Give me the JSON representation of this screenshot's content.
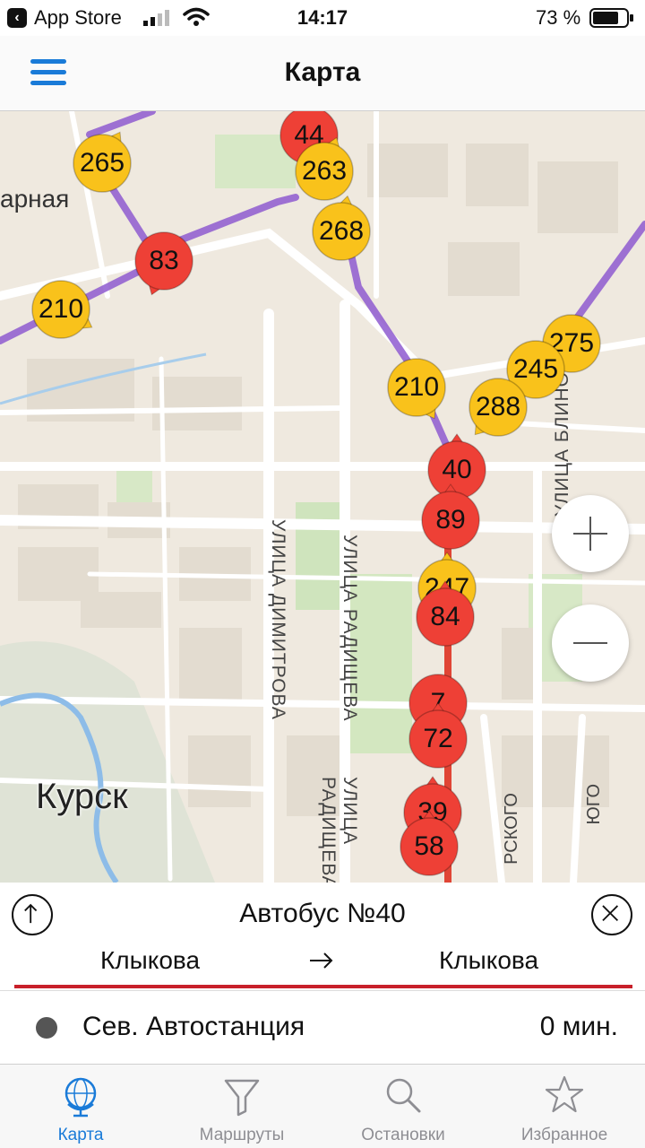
{
  "status_bar": {
    "carrier": "App Store",
    "time": "14:17",
    "battery": "73 %"
  },
  "nav": {
    "title": "Карта"
  },
  "map": {
    "labels": {
      "city": "Курск",
      "partial_top_left": "арная",
      "street_dimitrova": "УЛИЦА ДИМИТРОВА",
      "street_radishcheva_1": "УЛИЦА РАДИЩЕВА",
      "street_radishcheva_2": "УЛИЦА РАДИЩЕВА",
      "street_blinova": "УЛИЦА БЛИНО",
      "street_partial_1": "РСКОГО",
      "street_partial_2": "ЮГО"
    },
    "markers": [
      {
        "label": "44",
        "color": "red"
      },
      {
        "label": "265",
        "color": "yellow"
      },
      {
        "label": "263",
        "color": "yellow"
      },
      {
        "label": "83",
        "color": "red"
      },
      {
        "label": "268",
        "color": "yellow"
      },
      {
        "label": "210",
        "color": "yellow"
      },
      {
        "label": "210",
        "color": "yellow"
      },
      {
        "label": "275",
        "color": "yellow"
      },
      {
        "label": "245",
        "color": "yellow"
      },
      {
        "label": "288",
        "color": "yellow"
      },
      {
        "label": "40",
        "color": "red"
      },
      {
        "label": "89",
        "color": "red"
      },
      {
        "label": "247",
        "color": "yellow"
      },
      {
        "label": "84",
        "color": "red"
      },
      {
        "label": "7",
        "color": "red"
      },
      {
        "label": "72",
        "color": "red"
      },
      {
        "label": "39",
        "color": "red"
      },
      {
        "label": "58",
        "color": "red"
      }
    ],
    "zoom_in": "+",
    "zoom_out": "−"
  },
  "route_panel": {
    "title": "Автобус №40",
    "from": "Клыкова",
    "to": "Клыкова",
    "accent_color": "#c8202a",
    "stop": {
      "name": "Сев. Автостанция",
      "eta": "0 мин."
    }
  },
  "tabs": [
    {
      "label": "Карта",
      "icon": "globe-icon",
      "active": true
    },
    {
      "label": "Маршруты",
      "icon": "filter-icon",
      "active": false
    },
    {
      "label": "Остановки",
      "icon": "search-icon",
      "active": false
    },
    {
      "label": "Избранное",
      "icon": "star-icon",
      "active": false
    }
  ],
  "colors": {
    "accent": "#1a7bd8",
    "marker_red": "#ee4036",
    "marker_yellow": "#f9c21b",
    "route_purple": "#8e5bd0"
  }
}
